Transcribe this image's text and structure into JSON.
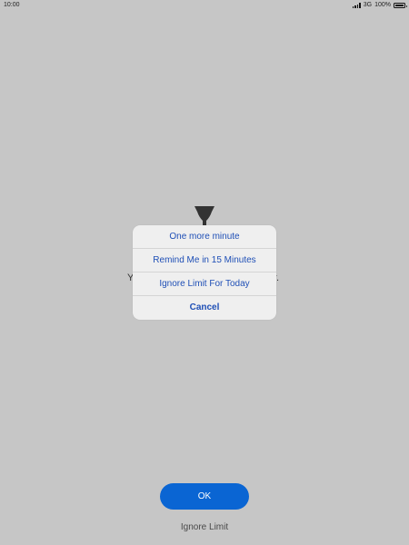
{
  "status_bar": {
    "time": "10:00",
    "network": "3G",
    "battery_percent": "100%",
    "battery_level": 1.0
  },
  "background_message": {
    "left_fragment": "Y",
    "right_fragment": "r."
  },
  "action_sheet": {
    "items": [
      {
        "label": "One more minute"
      },
      {
        "label": "Remind Me in 15 Minutes"
      },
      {
        "label": "Ignore Limit For Today"
      },
      {
        "label": "Cancel"
      }
    ]
  },
  "ok_button": {
    "label": "OK"
  },
  "ignore_limit": {
    "label": "Ignore Limit"
  },
  "colors": {
    "background": "#c6c6c6",
    "sheet_background": "#efefef",
    "sheet_text": "#1f4fb6",
    "primary_button": "#0a65d3"
  }
}
